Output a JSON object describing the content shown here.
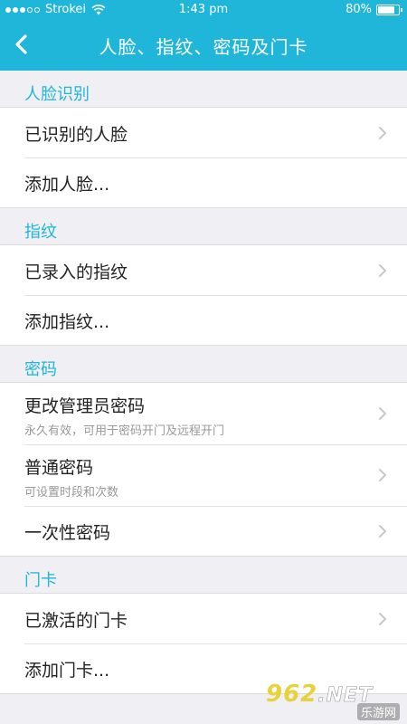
{
  "status_bar": {
    "carrier": "Strokei",
    "time": "1:43 pm",
    "battery": "80%",
    "battery_level": 0.8
  },
  "nav": {
    "title": "人脸、指纹、密码及门卡",
    "back_icon": "chevron-left-icon"
  },
  "sections": {
    "face": {
      "title": "人脸识别",
      "items": [
        {
          "label": "已识别的人脸",
          "chevron": true
        },
        {
          "label": "添加人脸...",
          "chevron": false
        }
      ]
    },
    "fingerprint": {
      "title": "指纹",
      "items": [
        {
          "label": "已录入的指纹",
          "chevron": true
        },
        {
          "label": "添加指纹...",
          "chevron": false
        }
      ]
    },
    "password": {
      "title": "密码",
      "items": [
        {
          "label": "更改管理员密码",
          "sub": "永久有效，可用于密码开门及远程开门",
          "chevron": true
        },
        {
          "label": "普通密码",
          "sub": "可设置时段和次数",
          "chevron": true
        },
        {
          "label": "一次性密码",
          "chevron": true
        }
      ]
    },
    "card": {
      "title": "门卡",
      "items": [
        {
          "label": "已激活的门卡",
          "chevron": true
        },
        {
          "label": "添加门卡...",
          "chevron": false
        }
      ]
    }
  },
  "watermark": {
    "number": "962",
    "net": ".NET",
    "site": "乐游网"
  },
  "colors": {
    "accent": "#1fb6d9",
    "background": "#efeff4",
    "text": "#222222",
    "subtext": "#999999"
  }
}
